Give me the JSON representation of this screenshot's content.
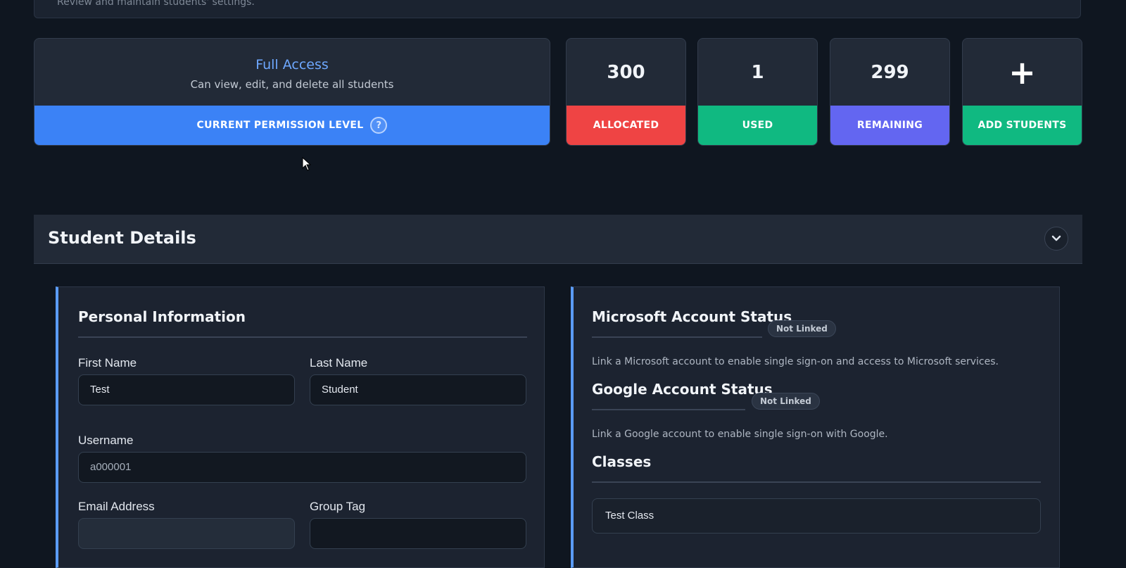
{
  "top_strip": {
    "text": "Review and maintain students' settings."
  },
  "permission": {
    "title": "Full Access",
    "subtitle": "Can view, edit, and delete all students",
    "bar_label": "CURRENT PERMISSION LEVEL",
    "help_glyph": "?",
    "color": "#3b82f6"
  },
  "stats": [
    {
      "value": "300",
      "label": "ALLOCATED",
      "color": "#ef4444"
    },
    {
      "value": "1",
      "label": "USED",
      "color": "#10b981"
    },
    {
      "value": "299",
      "label": "REMAINING",
      "color": "#6366f1"
    }
  ],
  "add_students": {
    "glyph": "+",
    "label": "ADD STUDENTS",
    "color": "#10b981"
  },
  "section": {
    "title": "Student Details"
  },
  "personal": {
    "heading": "Personal Information",
    "first_name": {
      "label": "First Name",
      "value": "Test"
    },
    "last_name": {
      "label": "Last Name",
      "value": "Student"
    },
    "username": {
      "label": "Username",
      "value": "a000001"
    },
    "email": {
      "label": "Email Address",
      "value": ""
    },
    "group_tag": {
      "label": "Group Tag",
      "value": ""
    }
  },
  "microsoft": {
    "heading": "Microsoft Account Status",
    "badge": "Not Linked",
    "description": "Link a Microsoft account to enable single sign-on and access to Microsoft services."
  },
  "google": {
    "heading": "Google Account Status",
    "badge": "Not Linked",
    "description": "Link a Google account to enable single sign-on with Google."
  },
  "classes": {
    "heading": "Classes",
    "items": [
      "Test Class"
    ]
  },
  "icons": {
    "help": "help-circle-icon",
    "plus": "plus-icon",
    "collapse": "chevron-down-icon",
    "cursor": "mouse-cursor-icon"
  }
}
